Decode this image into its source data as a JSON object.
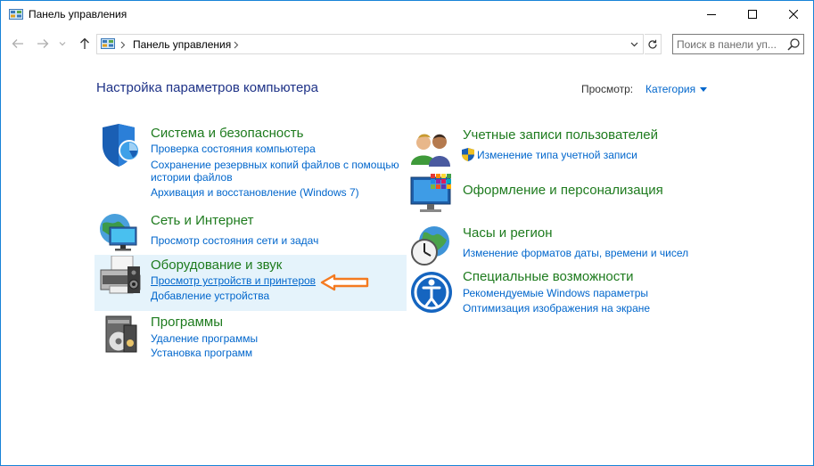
{
  "window": {
    "title": "Панель управления",
    "controls": {
      "minimize": "minimize",
      "maximize": "maximize",
      "close": "close"
    }
  },
  "address_bar": {
    "path": "Панель управления",
    "search_placeholder": "Поиск в панели уп..."
  },
  "header": {
    "title": "Настройка параметров компьютера",
    "view_label": "Просмотр:",
    "view_value": "Категория"
  },
  "categories": {
    "system": {
      "title": "Система и безопасность",
      "links": [
        "Проверка состояния компьютера",
        "Сохранение резервных копий файлов с помощью",
        "истории файлов",
        "Архивация и восстановление (Windows 7)"
      ]
    },
    "network": {
      "title": "Сеть и Интернет",
      "links": [
        "Просмотр состояния сети и задач"
      ]
    },
    "hardware": {
      "title": "Оборудование и звук",
      "links": [
        "Просмотр устройств и принтеров",
        "Добавление устройства"
      ]
    },
    "programs": {
      "title": "Программы",
      "links": [
        "Удаление программы",
        "Установка программ"
      ]
    },
    "accounts": {
      "title": "Учетные записи пользователей",
      "links": [
        "Изменение типа учетной записи"
      ]
    },
    "appearance": {
      "title": "Оформление и персонализация",
      "links": []
    },
    "clock": {
      "title": "Часы и регион",
      "links": [
        "Изменение форматов даты, времени и чисел"
      ]
    },
    "ease": {
      "title": "Специальные возможности",
      "links": [
        "Рекомендуемые Windows параметры",
        "Оптимизация изображения на экране"
      ]
    }
  },
  "colors": {
    "heading": "#1e3287",
    "category_title": "#1e7b1e",
    "link": "#0066cc",
    "highlight": "#e5f3fb",
    "arrow": "#f47a20"
  },
  "icons": {
    "app": "control-panel-icon",
    "system": "shield-icon",
    "network": "network-globe-icon",
    "hardware": "printer-icon",
    "programs": "programs-disc-icon",
    "accounts": "users-icon",
    "appearance": "monitor-palette-icon",
    "clock": "clock-globe-icon",
    "ease": "ease-of-access-icon"
  }
}
